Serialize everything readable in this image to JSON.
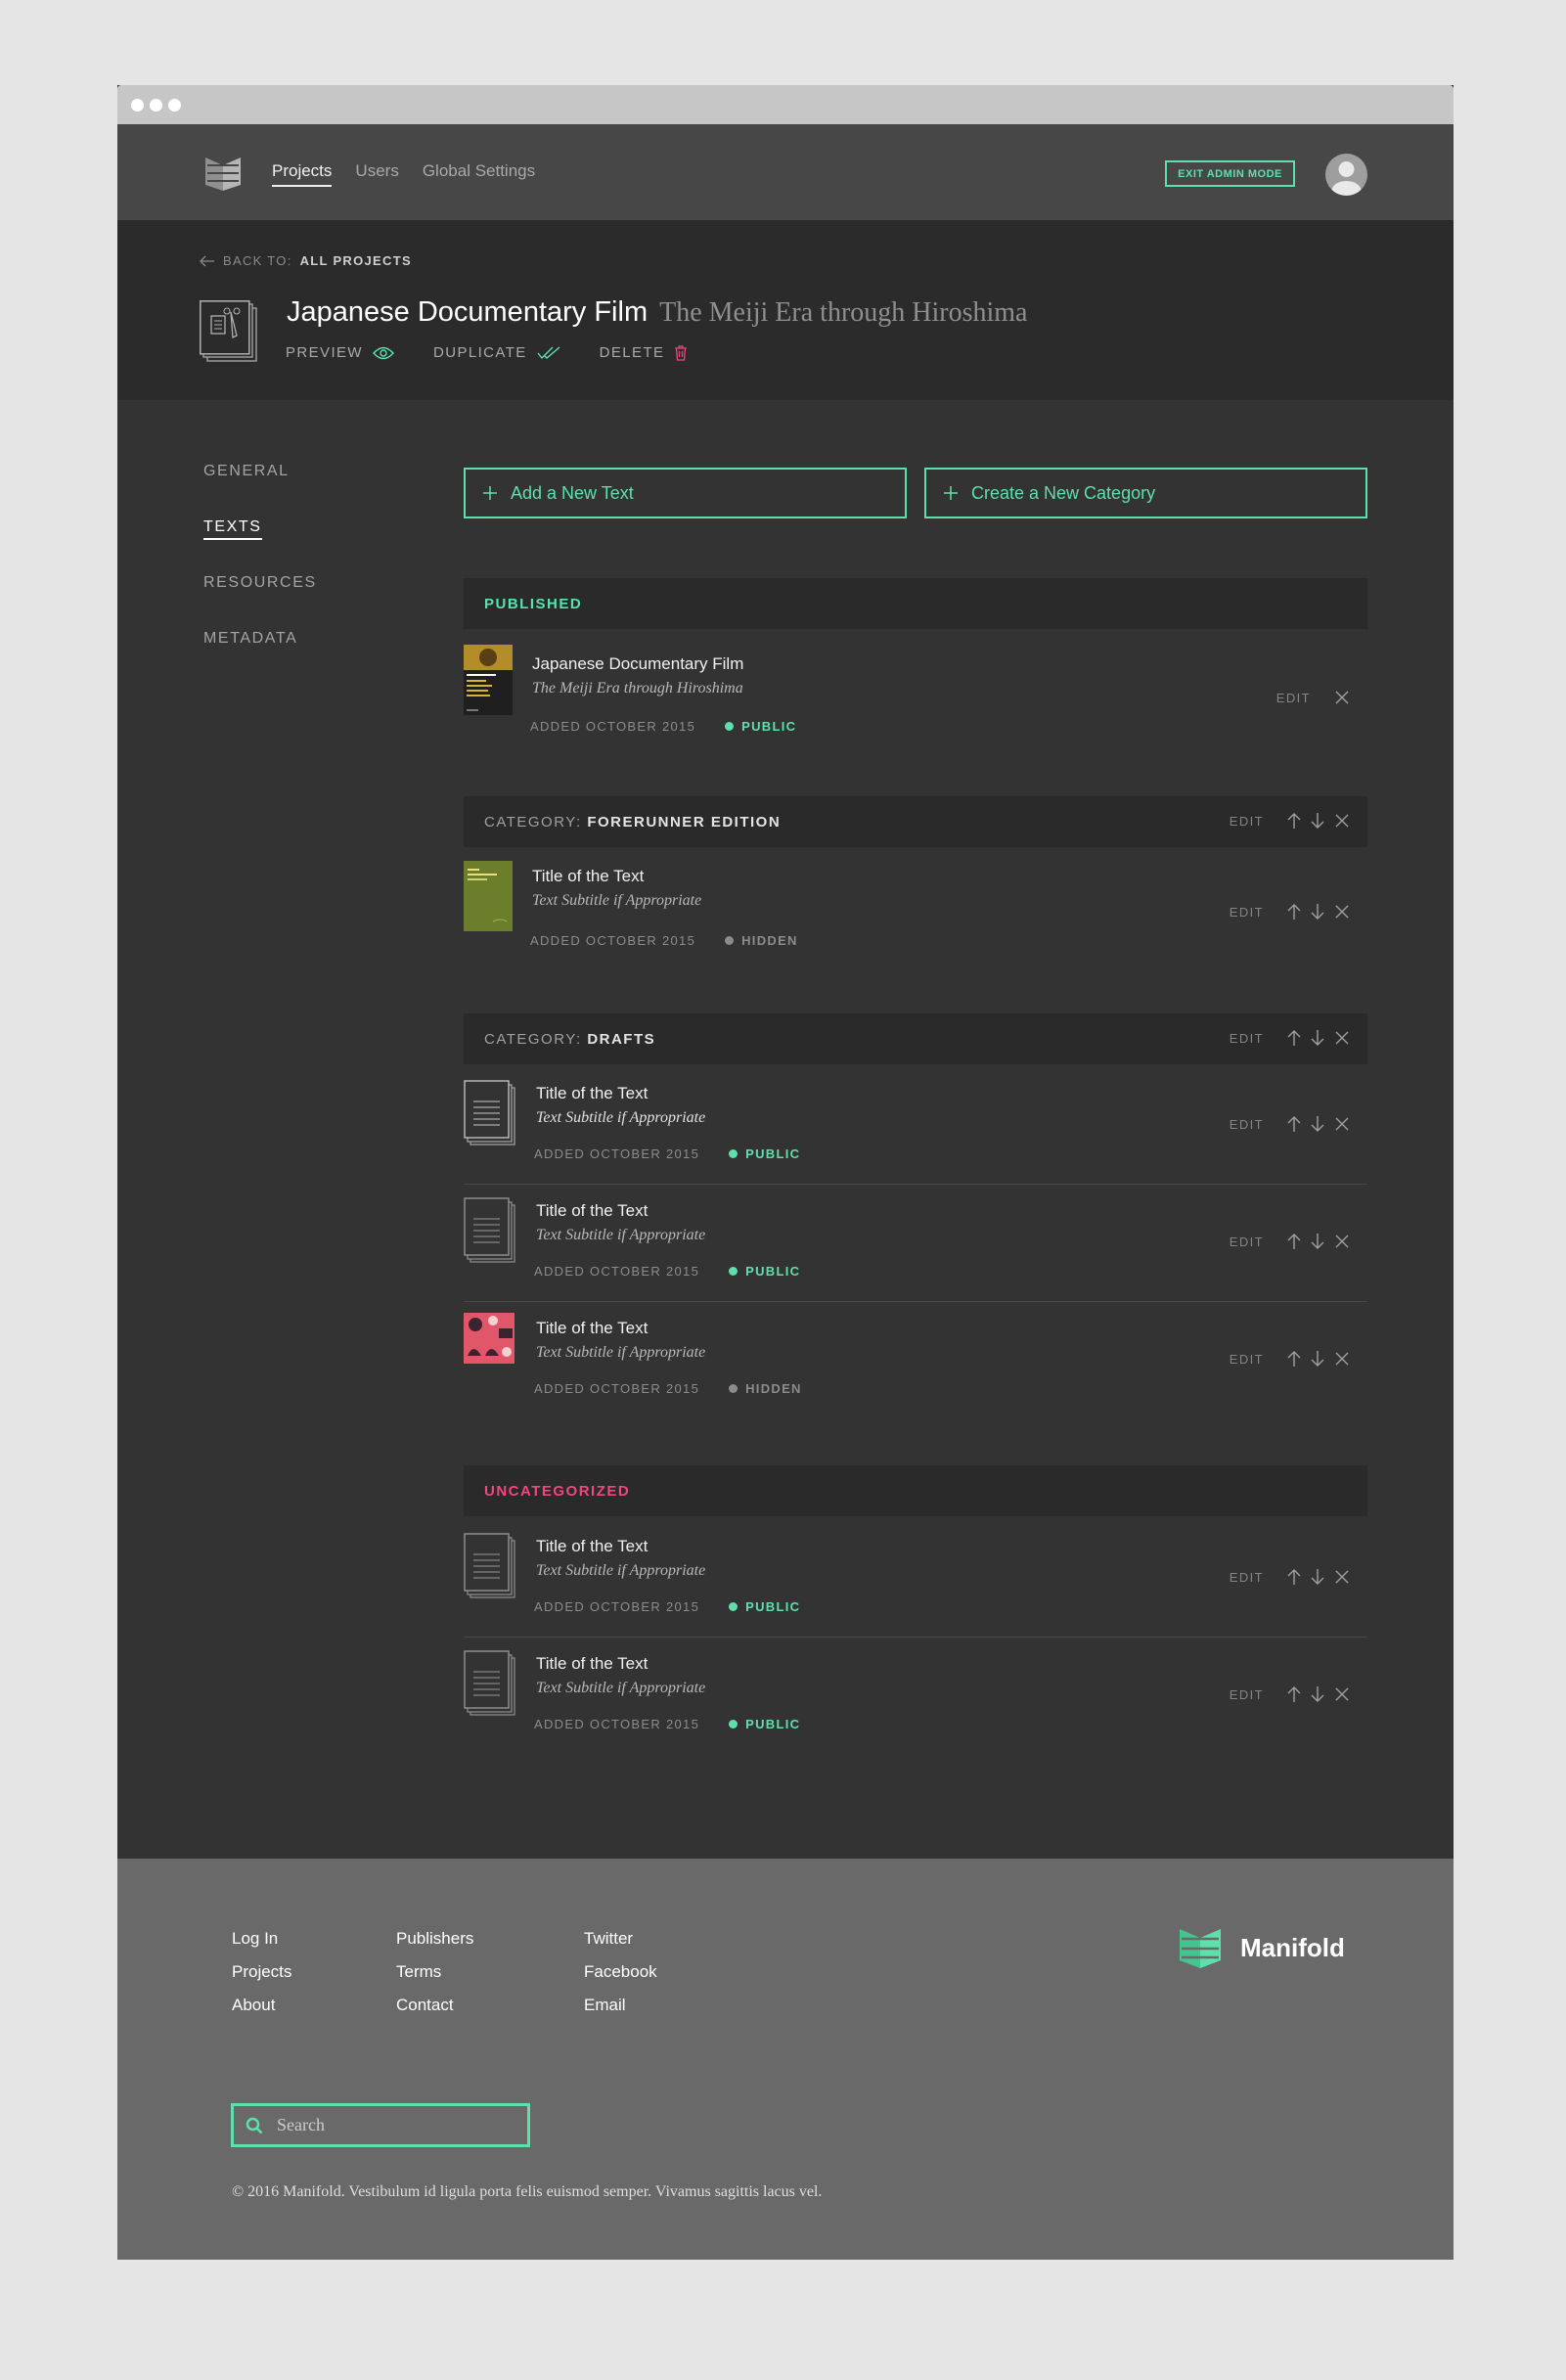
{
  "nav": {
    "items": [
      "Projects",
      "Users",
      "Global Settings"
    ],
    "exit_admin": "EXIT ADMIN MODE"
  },
  "header": {
    "back_prefix": "BACK TO:",
    "back_link": "ALL PROJECTS",
    "title": "Japanese Documentary Film",
    "subtitle": "The Meiji Era through Hiroshima",
    "actions": {
      "preview": "PREVIEW",
      "duplicate": "DUPLICATE",
      "delete": "DELETE"
    }
  },
  "sidebar": {
    "items": [
      "GENERAL",
      "TEXTS",
      "RESOURCES",
      "METADATA"
    ],
    "active": "TEXTS"
  },
  "buttons": {
    "add_text": "Add a New Text",
    "create_category": "Create a New Category"
  },
  "sections": {
    "published": {
      "label": "PUBLISHED"
    },
    "forerunner": {
      "prefix": "CATEGORY:",
      "name": "FORERUNNER EDITION"
    },
    "drafts": {
      "prefix": "CATEGORY:",
      "name": "DRAFTS"
    },
    "uncategorized": {
      "label": "UNCATEGORIZED"
    }
  },
  "controls": {
    "edit": "EDIT"
  },
  "texts": {
    "published": {
      "title": "Japanese Documentary Film",
      "subtitle": "The Meiji Era through Hiroshima",
      "added": "ADDED OCTOBER 2015",
      "status": "PUBLIC"
    },
    "forerunner": {
      "title": "Title of the Text",
      "subtitle": "Text Subtitle if Appropriate",
      "added": "ADDED OCTOBER 2015",
      "status": "HIDDEN"
    },
    "drafts": [
      {
        "title": "Title of the Text",
        "subtitle": "Text Subtitle if Appropriate",
        "added": "ADDED OCTOBER 2015",
        "status": "PUBLIC"
      },
      {
        "title": "Title of the Text",
        "subtitle": "Text Subtitle if Appropriate",
        "added": "ADDED OCTOBER 2015",
        "status": "PUBLIC"
      },
      {
        "title": "Title of the Text",
        "subtitle": "Text Subtitle if Appropriate",
        "added": "ADDED OCTOBER 2015",
        "status": "HIDDEN"
      }
    ],
    "uncategorized": [
      {
        "title": "Title of the Text",
        "subtitle": "Text Subtitle if Appropriate",
        "added": "ADDED OCTOBER 2015",
        "status": "PUBLIC"
      },
      {
        "title": "Title of the Text",
        "subtitle": "Text Subtitle if Appropriate",
        "added": "ADDED OCTOBER 2015",
        "status": "PUBLIC"
      }
    ]
  },
  "footer": {
    "col1": [
      "Log In",
      "Projects",
      "About"
    ],
    "col2": [
      "Publishers",
      "Terms",
      "Contact"
    ],
    "col3": [
      "Twitter",
      "Facebook",
      "Email"
    ],
    "brand": "Manifold",
    "search_placeholder": "Search",
    "copyright": "© 2016 Manifold. Vestibulum id ligula porta felis euismod semper. Vivamus sagittis lacus vel."
  },
  "colors": {
    "accent": "#5ee0ad",
    "alert": "#f1467e",
    "hidden": "#8c8c8c"
  }
}
